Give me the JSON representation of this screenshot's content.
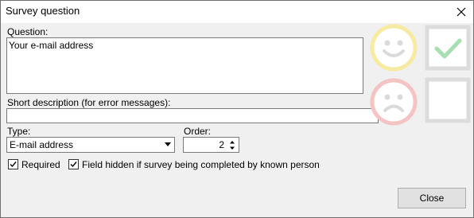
{
  "window": {
    "title": "Survey question"
  },
  "question": {
    "label": "Question:",
    "value": "Your e-mail address"
  },
  "short_description": {
    "label": "Short description (for error messages):",
    "value": ""
  },
  "type": {
    "label": "Type:",
    "selected": "E-mail address"
  },
  "order": {
    "label": "Order:",
    "value": "2"
  },
  "options": {
    "required": {
      "label": "Required",
      "checked": true
    },
    "hidden": {
      "label": "Field hidden if survey being completed by known person",
      "checked": true
    }
  },
  "buttons": {
    "close": "Close"
  },
  "icons": {
    "happy": "happy-face-icon",
    "sad": "sad-face-icon",
    "check": "checkmark-box-icon",
    "empty": "empty-box-icon"
  },
  "colors": {
    "happy_ring": "#f7eba3",
    "sad_ring": "#f4c4c4",
    "face": "#dadada",
    "check": "#a8dfb2"
  }
}
